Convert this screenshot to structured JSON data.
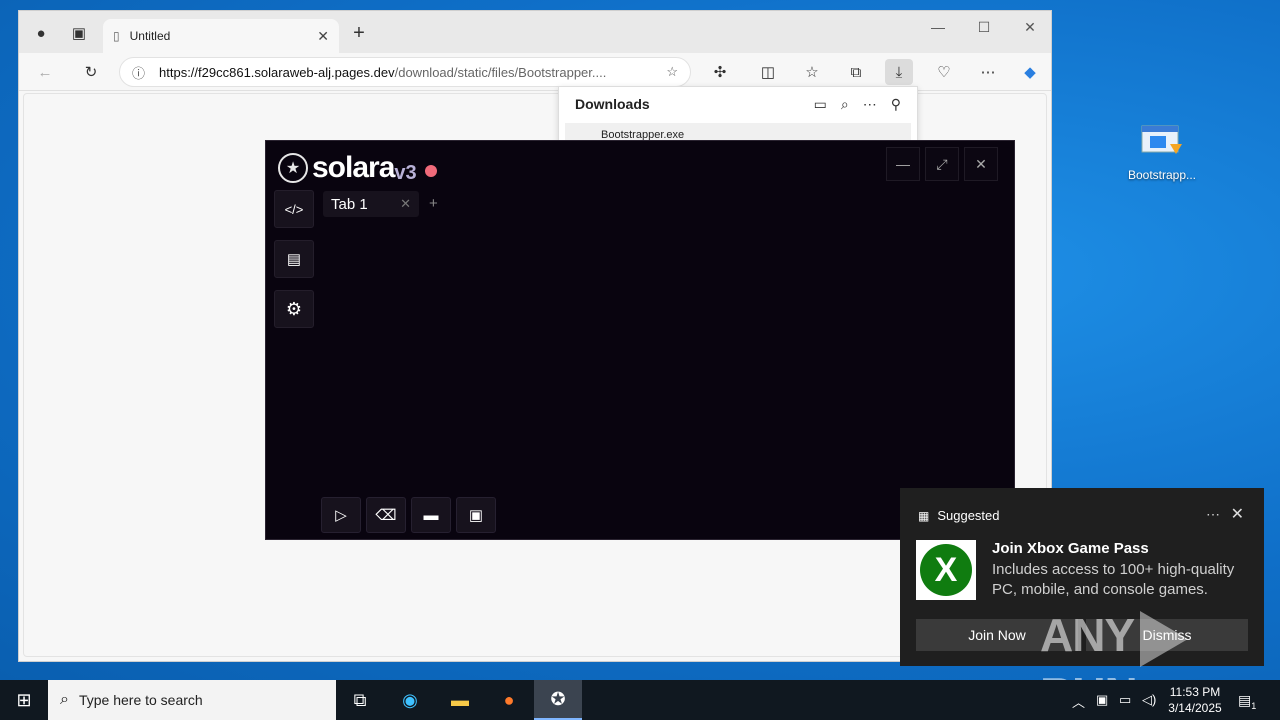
{
  "browser": {
    "tab_title": "Untitled",
    "url_host": "https://f29cc861.solaraweb-alj.pages.dev",
    "url_path": "/download/static/files/Bootstrapper....",
    "downloads": {
      "title": "Downloads",
      "item": "Bootstrapper.exe"
    }
  },
  "desktop": {
    "icon_label": "Bootstrapp..."
  },
  "solara": {
    "logo_name": "solara",
    "logo_version": "v3",
    "tab_label": "Tab 1",
    "add_tab": "+",
    "status_color": "#f06a7a"
  },
  "toast": {
    "source": "Suggested",
    "title": "Join Xbox Game Pass",
    "body": "Includes access to 100+ high-quality PC, mobile, and console games.",
    "join_label": "Join Now",
    "dismiss_label": "Dismiss"
  },
  "watermark": {
    "left": "ANY",
    "right": "RUN"
  },
  "taskbar": {
    "search_placeholder": "Type here to search",
    "time": "11:53 PM",
    "date": "3/14/2025",
    "notification_count": "1"
  }
}
